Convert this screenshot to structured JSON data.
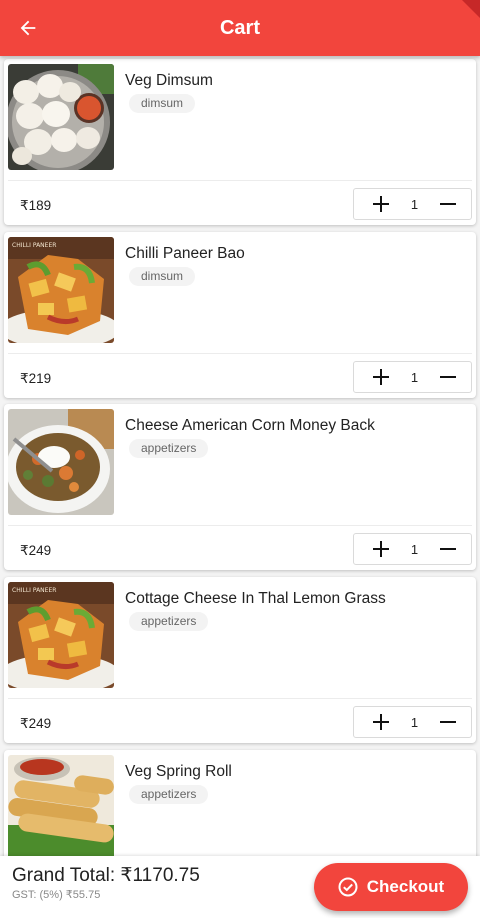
{
  "app": {
    "title": "Cart",
    "accent": "#f2453d"
  },
  "items": [
    {
      "name": "Veg Dimsum",
      "category": "dimsum",
      "price": "₹189",
      "qty": "1"
    },
    {
      "name": "Chilli Paneer Bao",
      "category": "dimsum",
      "price": "₹219",
      "qty": "1"
    },
    {
      "name": "Cheese American Corn Money Back",
      "category": "appetizers",
      "price": "₹249",
      "qty": "1"
    },
    {
      "name": "Cottage Cheese In Thal Lemon Grass",
      "category": "appetizers",
      "price": "₹249",
      "qty": "1"
    },
    {
      "name": "Veg Spring Roll",
      "category": "appetizers",
      "price": "",
      "qty": ""
    }
  ],
  "image_labels": {
    "chilli_paneer": "CHILLI PANEER"
  },
  "footer": {
    "grand_total": "Grand Total: ₹1170.75",
    "gst": "GST: (5%) ₹55.75",
    "checkout_label": "Checkout"
  }
}
